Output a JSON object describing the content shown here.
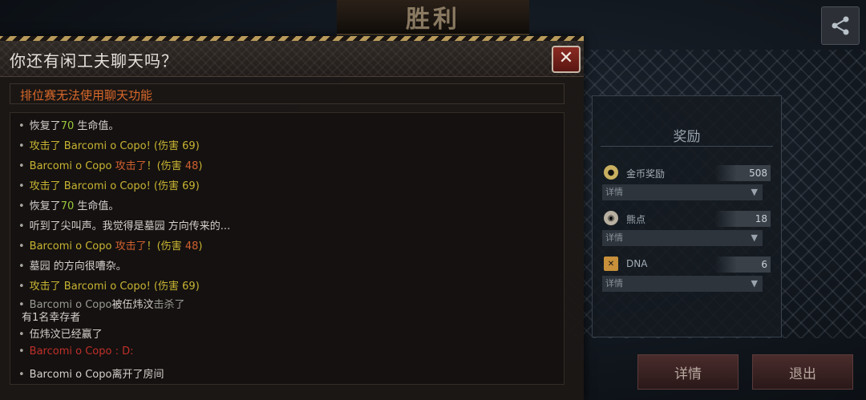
{
  "background": {
    "victory_title": "胜利",
    "share_icon": "share-icon"
  },
  "rewards": {
    "title": "奖励",
    "items": [
      {
        "label": "金币奖励",
        "value": "508",
        "detail": "详情",
        "icon": "coin-icon",
        "color": "#c8b060"
      },
      {
        "label": "熊点",
        "value": "18",
        "detail": "详情",
        "icon": "bear-point-icon",
        "color": "#b8b0a0"
      },
      {
        "label": "DNA",
        "value": "6",
        "detail": "详情",
        "icon": "dna-icon",
        "color": "#c8903a"
      }
    ]
  },
  "buttons": {
    "details": "详情",
    "exit": "退出"
  },
  "chat": {
    "title": "你还有闲工夫聊天吗？",
    "close": "✕",
    "notice": "排位赛无法使用聊天功能",
    "bullet": "•",
    "messages": [
      {
        "parts": [
          {
            "t": "恢复了",
            "c": ""
          },
          {
            "t": "70",
            "c": "g"
          },
          {
            "t": " 生命值。",
            "c": ""
          }
        ]
      },
      {
        "parts": [
          {
            "t": "攻击了 Barcomi o Copo! (伤害 ",
            "c": "y"
          },
          {
            "t": "69",
            "c": "y"
          },
          {
            "t": ")",
            "c": "y"
          }
        ]
      },
      {
        "parts": [
          {
            "t": "Barcomi o Copo  ",
            "c": "y"
          },
          {
            "t": "攻击了",
            "c": "o"
          },
          {
            "t": "！(伤害 ",
            "c": "y"
          },
          {
            "t": "48",
            "c": "o"
          },
          {
            "t": ")",
            "c": "y"
          }
        ]
      },
      {
        "parts": [
          {
            "t": "攻击了 Barcomi o Copo! (伤害 ",
            "c": "y"
          },
          {
            "t": "69",
            "c": "y"
          },
          {
            "t": ")",
            "c": "y"
          }
        ]
      },
      {
        "parts": [
          {
            "t": "恢复了",
            "c": ""
          },
          {
            "t": "70",
            "c": "g"
          },
          {
            "t": " 生命值。",
            "c": ""
          }
        ]
      },
      {
        "parts": [
          {
            "t": "听到了尖叫声。我觉得是墓园 方向传来的...",
            "c": ""
          }
        ]
      },
      {
        "parts": [
          {
            "t": "Barcomi o Copo  ",
            "c": "y"
          },
          {
            "t": "攻击了",
            "c": "o"
          },
          {
            "t": "！(伤害 ",
            "c": "y"
          },
          {
            "t": "48",
            "c": "o"
          },
          {
            "t": ")",
            "c": "y"
          }
        ]
      },
      {
        "parts": [
          {
            "t": "墓园 的方向很嘈杂。",
            "c": ""
          }
        ]
      },
      {
        "parts": [
          {
            "t": "攻击了 Barcomi o Copo! (伤害 ",
            "c": "y"
          },
          {
            "t": "69",
            "c": "y"
          },
          {
            "t": ")",
            "c": "y"
          }
        ]
      },
      {
        "parts": [
          {
            "t": "Barcomi o Copo",
            "c": "lg"
          },
          {
            "t": "被伍炜汶",
            "c": ""
          },
          {
            "t": "击杀了",
            "c": "lg"
          }
        ],
        "line2": "有1名幸存者"
      },
      {
        "parts": [
          {
            "t": "伍炜汶已经赢了",
            "c": ""
          }
        ]
      },
      {
        "parts": [
          {
            "t": "Barcomi o Copo : D:",
            "c": "red"
          }
        ]
      },
      {
        "parts": [
          {
            "t": "Barcomi o Copo",
            "c": ""
          },
          {
            "t": "离开了房间",
            "c": ""
          }
        ]
      }
    ]
  }
}
